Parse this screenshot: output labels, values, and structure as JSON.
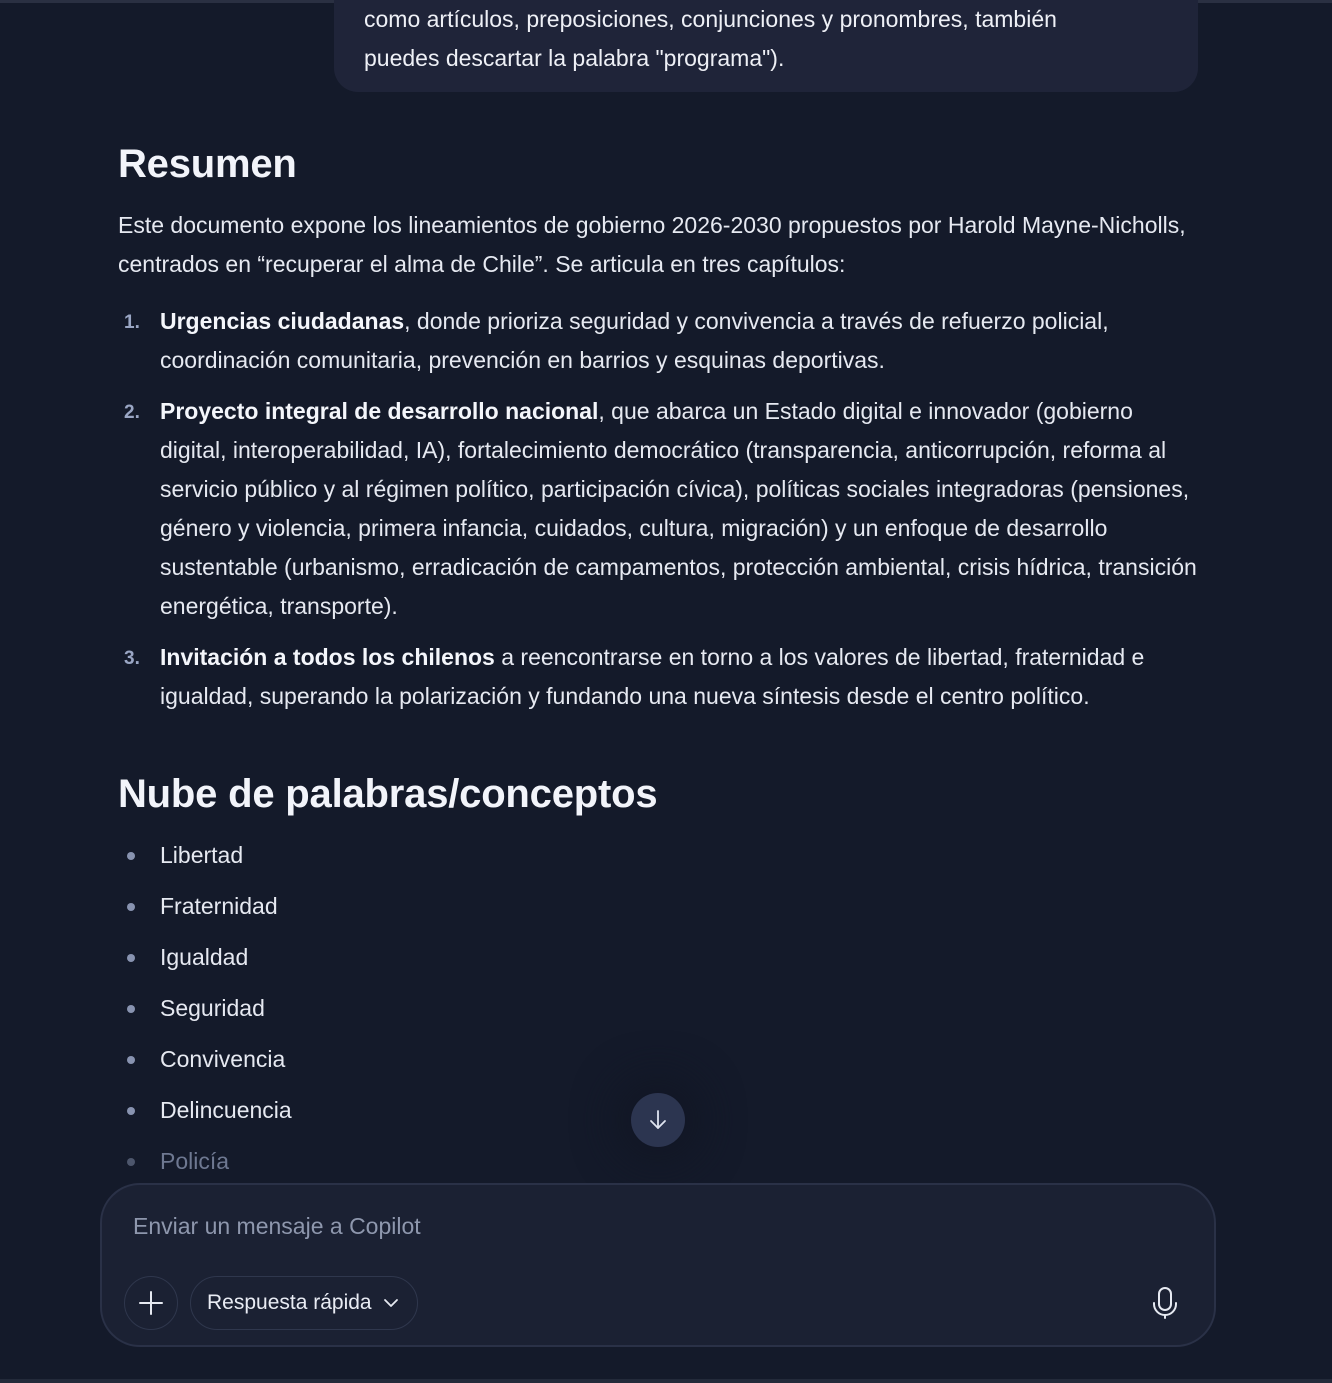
{
  "user_message": {
    "line1": "como artículos, preposiciones, conjunciones y pronombres, también",
    "line2": "puedes descartar la palabra \"programa\")."
  },
  "summary": {
    "heading": "Resumen",
    "intro": "Este documento expone los lineamientos de gobierno 2026-2030 propuestos por Harold Mayne-Nicholls, centrados en “recuperar el alma de Chile”. Se articula en tres capítulos:",
    "chapters": [
      {
        "number": "1.",
        "title": "Urgencias ciudadanas",
        "text": ", donde prioriza seguridad y convivencia a través de refuerzo policial, coordinación comunitaria, prevención en barrios y esquinas deportivas."
      },
      {
        "number": "2.",
        "title": "Proyecto integral de desarrollo nacional",
        "text": ", que abarca un Estado digital e innovador (gobierno digital, interoperabilidad, IA), fortalecimiento democrático (transparencia, anticorrupción, reforma al servicio público y al régimen político, participación cívica), políticas sociales integradoras (pensiones, género y violencia, primera infancia, cuidados, cultura, migración) y un enfoque de desarrollo sustentable (urbanismo, erradicación de campamentos, protección ambiental, crisis hídrica, transición energética, transporte)."
      },
      {
        "number": "3.",
        "title": "Invitación a todos los chilenos",
        "text": " a reencontrarse en torno a los valores de libertad, fraternidad e igualdad, superando la polarización y fundando una nueva síntesis desde el centro político."
      }
    ]
  },
  "word_cloud": {
    "heading": "Nube de palabras/conceptos",
    "words": [
      "Libertad",
      "Fraternidad",
      "Igualdad",
      "Seguridad",
      "Convivencia",
      "Delincuencia",
      "Policía"
    ]
  },
  "composer": {
    "placeholder": "Enviar un mensaje a Copilot",
    "mode_label": "Respuesta rápida"
  },
  "icons": {
    "scroll": "arrow-down-icon",
    "add": "plus-icon",
    "mode": "chevron-down-icon",
    "voice": "microphone-icon"
  }
}
